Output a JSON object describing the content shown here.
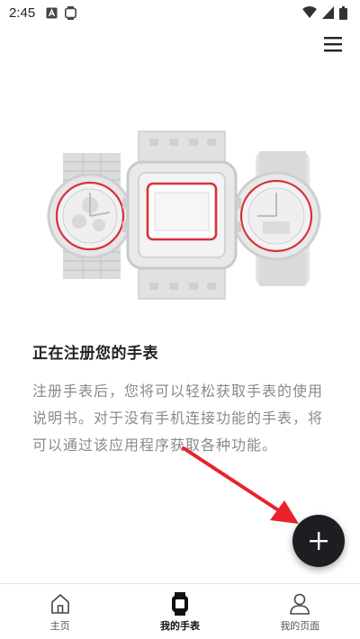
{
  "status_bar": {
    "time": "2:45",
    "icons": [
      "a-icon",
      "watch-status-icon",
      "wifi-icon",
      "signal-icon",
      "battery-icon"
    ]
  },
  "header": {
    "menu_icon": "hamburger-menu-icon"
  },
  "hero": {
    "illustration": "three-watches",
    "accent_color": "#d8313a"
  },
  "main": {
    "title": "正在注册您的手表",
    "description": "注册手表后，您将可以轻松获取手表的使用说明书。对于没有手机连接功能的手表，将可以通过该应用程序获取各种功能。"
  },
  "fab": {
    "icon": "plus-icon",
    "color": "#1c1e22"
  },
  "annotation": {
    "arrow_color": "#e8232a"
  },
  "bottom_nav": {
    "items": [
      {
        "label": "主页",
        "icon": "home-icon",
        "active": false
      },
      {
        "label": "我的手表",
        "icon": "watch-icon",
        "active": true
      },
      {
        "label": "我的页面",
        "icon": "person-icon",
        "active": false
      }
    ]
  }
}
